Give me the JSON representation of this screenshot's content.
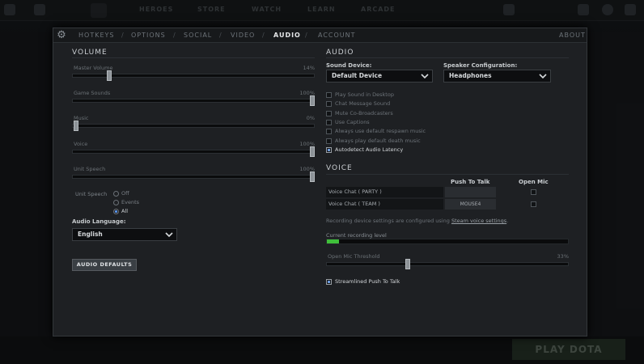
{
  "background": {
    "top_nav": [
      "HEROES",
      "STORE",
      "WATCH",
      "LEARN",
      "ARCADE"
    ],
    "play_button": "PLAY DOTA"
  },
  "tabs": [
    {
      "label": "HOTKEYS",
      "active": false
    },
    {
      "label": "OPTIONS",
      "active": false
    },
    {
      "label": "SOCIAL",
      "active": false
    },
    {
      "label": "VIDEO",
      "active": false
    },
    {
      "label": "AUDIO",
      "active": true
    },
    {
      "label": "ACCOUNT",
      "active": false
    }
  ],
  "about_label": "ABOUT",
  "volume": {
    "title": "VOLUME",
    "sliders": [
      {
        "label": "Master Volume",
        "value": "14%",
        "fraction": 0.14
      },
      {
        "label": "Game Sounds",
        "value": "100%",
        "fraction": 1.0
      },
      {
        "label": "Music",
        "value": "0%",
        "fraction": 0.0
      },
      {
        "label": "Voice",
        "value": "100%",
        "fraction": 1.0
      },
      {
        "label": "Unit Speech",
        "value": "100%",
        "fraction": 1.0
      }
    ],
    "unit_speech": {
      "label": "Unit Speech",
      "options": [
        "Off",
        "Events",
        "All"
      ],
      "selected": "All"
    },
    "audio_language": {
      "label": "Audio Language:",
      "value": "English"
    },
    "defaults_button": "AUDIO DEFAULTS"
  },
  "audio": {
    "title": "AUDIO",
    "sound_device": {
      "label": "Sound Device:",
      "value": "Default Device"
    },
    "speaker_config": {
      "label": "Speaker Configuration:",
      "value": "Headphones"
    },
    "options": [
      {
        "label": "Play Sound in Desktop",
        "checked": false
      },
      {
        "label": "Chat Message Sound",
        "checked": false
      },
      {
        "label": "Mute Co-Broadcasters",
        "checked": false
      },
      {
        "label": "Use Captions",
        "checked": false
      },
      {
        "label": "Always use default respawn music",
        "checked": false
      },
      {
        "label": "Always play default death music",
        "checked": false
      },
      {
        "label": "Autodetect Audio Latency",
        "checked": true
      }
    ]
  },
  "voice": {
    "title": "VOICE",
    "col_push": "Push To Talk",
    "col_open": "Open Mic",
    "rows": [
      {
        "label": "Voice Chat ( PARTY )",
        "push": "",
        "open_mic": false
      },
      {
        "label": "Voice Chat ( TEAM )",
        "push": "MOUSE4",
        "open_mic": false
      }
    ],
    "recording_note": "Recording device settings are configured using",
    "recording_link": "Steam voice settings",
    "recording_note_end": ".",
    "current_level_label": "Current recording level",
    "current_level": 0.05,
    "threshold_label": "Open Mic Threshold",
    "threshold_value": "33%",
    "threshold_fraction": 0.33,
    "streamlined": {
      "label": "Streamlined Push To Talk",
      "checked": true
    }
  },
  "colors": {
    "accent": "#5c9cff",
    "level": "#3fbf3a"
  }
}
